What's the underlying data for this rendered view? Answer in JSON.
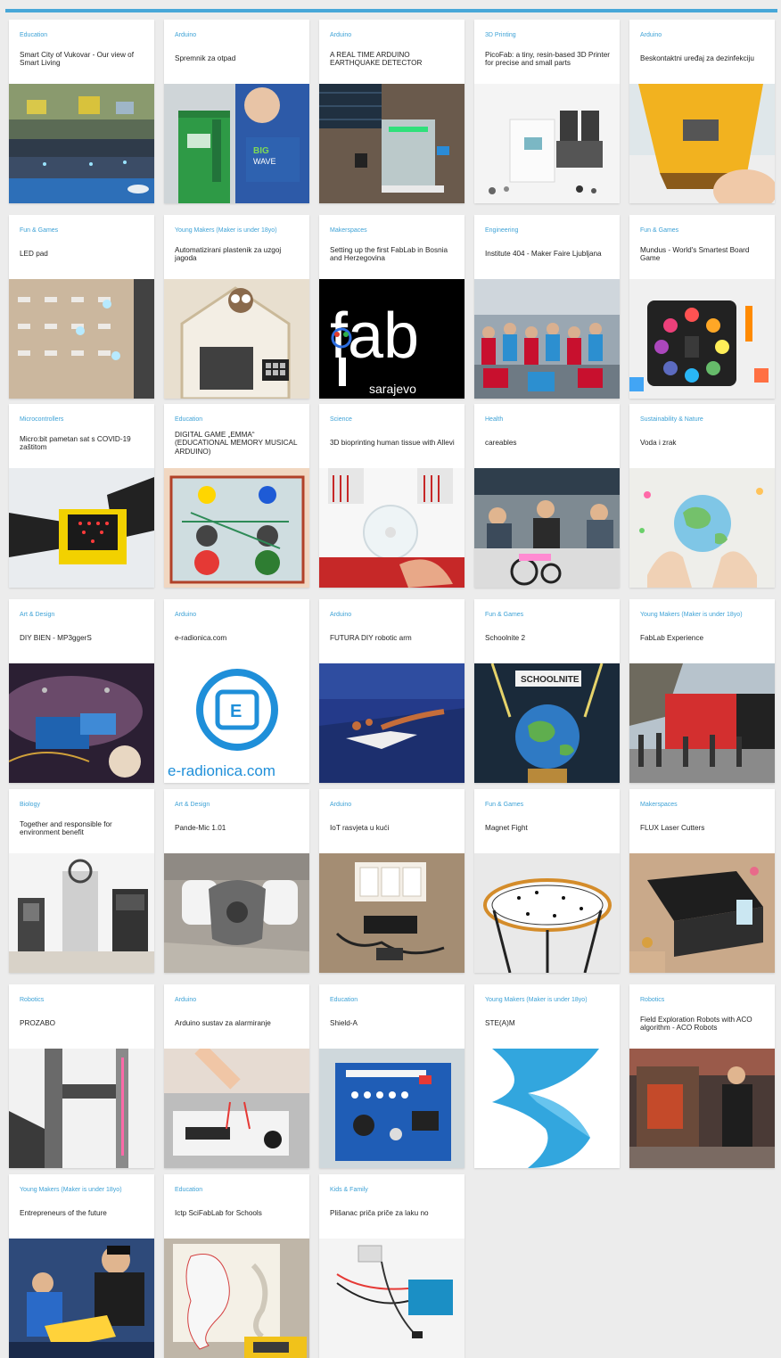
{
  "cards": [
    {
      "category": "Education",
      "title": "Smart City of Vukovar - Our view of Smart Living",
      "image": "smart-city-model"
    },
    {
      "category": "Arduino",
      "title": "Spremnik za otpad",
      "image": "boy-with-green-bin"
    },
    {
      "category": "Arduino",
      "title": "A REAL TIME ARDUINO EARTHQUAKE DETECTOR",
      "image": "earthquake-detector"
    },
    {
      "category": "3D Printing",
      "title": "PicoFab: a tiny, resin-based 3D Printer for precise and small parts",
      "image": "resin-printer"
    },
    {
      "category": "Arduino",
      "title": "Beskontaktni uređaj za dezinfekciju",
      "image": "disinfection-device"
    },
    {
      "category": "Fun & Games",
      "title": "LED pad",
      "image": "led-pad"
    },
    {
      "category": "Young Makers (Maker is under 18yo)",
      "title": "Automatizirani plastenik za uzgoj jagoda",
      "image": "greenhouse-owl"
    },
    {
      "category": "Makerspaces",
      "title": "Setting up the first FabLab in Bosnia and Herzegovina",
      "image": "fab-sarajevo-logo"
    },
    {
      "category": "Engineering",
      "title": "Institute 404 - Maker Faire Ljubljana",
      "image": "group-photo"
    },
    {
      "category": "Fun & Games",
      "title": "Mundus - World's Smartest Board Game",
      "image": "board-game"
    },
    {
      "category": "Microcontrollers",
      "title": "Micro:bit pametan sat s COVID-19 zaštitom",
      "image": "microbit-watch"
    },
    {
      "category": "Education",
      "title": "DIGITAL GAME „EMMA“ (EDUCATIONAL MEMORY MUSICAL ARDUINO)",
      "image": "arcade-buttons"
    },
    {
      "category": "Science",
      "title": "3D bioprinting human tissue with Allevi",
      "image": "bioprinter"
    },
    {
      "category": "Health",
      "title": "careables",
      "image": "workshop-wheelchair"
    },
    {
      "category": "Sustainability & Nature",
      "title": "Voda i zrak",
      "image": "earth-drawing"
    },
    {
      "category": "Art & Design",
      "title": "DIY BIEN - MP3ggerS",
      "image": "circuit-felt"
    },
    {
      "category": "Arduino",
      "title": "e-radionica.com",
      "image": "e-radionica-logo"
    },
    {
      "category": "Arduino",
      "title": "FUTURA DIY robotic arm",
      "image": "robotic-arm"
    },
    {
      "category": "Fun & Games",
      "title": "Schoolnite 2",
      "image": "schoolnite-globe"
    },
    {
      "category": "Young Makers (Maker is under 18yo)",
      "title": "FabLab Experience",
      "image": "red-truck"
    },
    {
      "category": "Biology",
      "title": "Together and responsible for environment benefit",
      "image": "lab-machines"
    },
    {
      "category": "Art & Design",
      "title": "Pande-Mic 1.01",
      "image": "respirator-mask"
    },
    {
      "category": "Arduino",
      "title": "IoT rasvjeta u kući",
      "image": "wall-switch"
    },
    {
      "category": "Fun & Games",
      "title": "Magnet Fight",
      "image": "magnet-table"
    },
    {
      "category": "Makerspaces",
      "title": "FLUX Laser Cutters",
      "image": "laser-cutter"
    },
    {
      "category": "Robotics",
      "title": "PROZABO",
      "image": "prozabo-frame"
    },
    {
      "category": "Arduino",
      "title": "Arduino sustav za alarmiranje",
      "image": "alarm-breadboard"
    },
    {
      "category": "Education",
      "title": "Shield-A",
      "image": "blue-shield-board"
    },
    {
      "category": "Young Makers (Maker is under 18yo)",
      "title": "STE(A)M",
      "image": "steam-logo"
    },
    {
      "category": "Robotics",
      "title": "Field Exploration Robots with ACO algorithm - ACO Robots",
      "image": "man-with-robot"
    },
    {
      "category": "Young Makers (Maker is under 18yo)",
      "title": "Entrepreneurs of the future",
      "image": "students-yellow"
    },
    {
      "category": "Education",
      "title": "Ictp SciFabLab for Schools",
      "image": "relief-map"
    },
    {
      "category": "Kids & Family",
      "title": "Plišanac priča priče za laku no",
      "image": "arduino-wires"
    }
  ]
}
